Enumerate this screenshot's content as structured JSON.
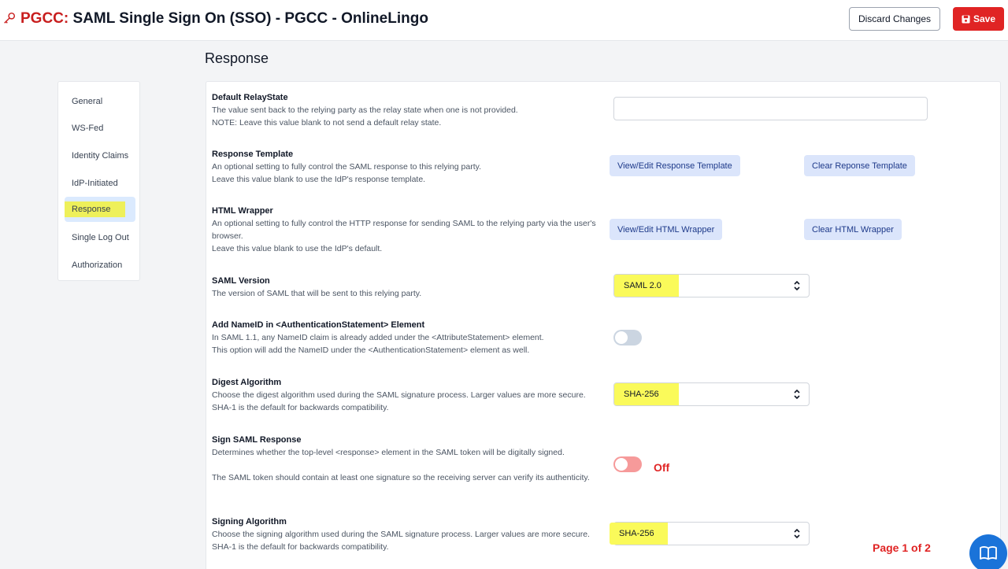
{
  "header": {
    "org": "PGCC:",
    "title": "SAML Single Sign On (SSO) - PGCC - OnlineLingo",
    "discard_label": "Discard Changes",
    "save_label": "Save",
    "save_color": "#e02424"
  },
  "section_title": "Response",
  "sidebar": {
    "items": [
      {
        "label": "General"
      },
      {
        "label": "WS-Fed"
      },
      {
        "label": "Identity Claims"
      },
      {
        "label": "IdP-Initiated"
      },
      {
        "label": "Response",
        "active": true
      },
      {
        "label": "Single Log Out"
      },
      {
        "label": "Authorization"
      }
    ]
  },
  "settings": {
    "relay_state": {
      "label": "Default RelayState",
      "desc1": "The value sent back to the relying party as the relay state when one is not provided.",
      "desc2": "NOTE: Leave this value blank to not send a default relay state.",
      "value": ""
    },
    "response_template": {
      "label": "Response Template",
      "desc1": "An optional setting to fully control the SAML response to this relying party.",
      "desc2": "Leave this value blank to use the IdP's response template.",
      "edit_label": "View/Edit Response Template",
      "clear_label": "Clear Reponse Template"
    },
    "html_wrapper": {
      "label": "HTML Wrapper",
      "desc1": "An optional setting to fully control the HTTP response for sending SAML to the relying party via the user's browser.",
      "desc2": "Leave this value blank to use the IdP's default.",
      "edit_label": "View/Edit HTML Wrapper",
      "clear_label": "Clear HTML Wrapper"
    },
    "saml_version": {
      "label": "SAML Version",
      "desc1": "The version of SAML that will be sent to this relying party.",
      "value": "SAML 2.0"
    },
    "add_nameid": {
      "label": "Add NameID in <AuthenticationStatement> Element",
      "desc1": "In SAML 1.1, any NameID claim is already added under the <AttributeStatement> element.",
      "desc2": "This option will add the NameID under the <AuthenticationStatement> element as well.",
      "enabled": false
    },
    "digest_algorithm": {
      "label": "Digest Algorithm",
      "desc1": "Choose the digest algorithm used during the SAML signature process. Larger values are more secure.",
      "desc2": "SHA-1 is the default for backwards compatibility.",
      "value": "SHA-256"
    },
    "sign_response": {
      "label": "Sign SAML Response",
      "desc1": "Determines whether the top-level <response> element in the SAML token will be digitally signed.",
      "desc2": "The SAML token should contain at least one signature so the receiving server can verify its authenticity.",
      "enabled": false,
      "state_text": "Off"
    },
    "signing_algorithm": {
      "label": "Signing Algorithm",
      "desc1": "Choose the signing algorithm used during the SAML signature process. Larger values are more secure.",
      "desc2": "SHA-1 is the default for backwards compatibility.",
      "value": "SHA-256"
    }
  },
  "page_indicator": "Page 1 of 2",
  "icons": {
    "title": "key-icon",
    "save": "save-icon",
    "select": "chevron-updown-icon",
    "help": "book-icon"
  }
}
